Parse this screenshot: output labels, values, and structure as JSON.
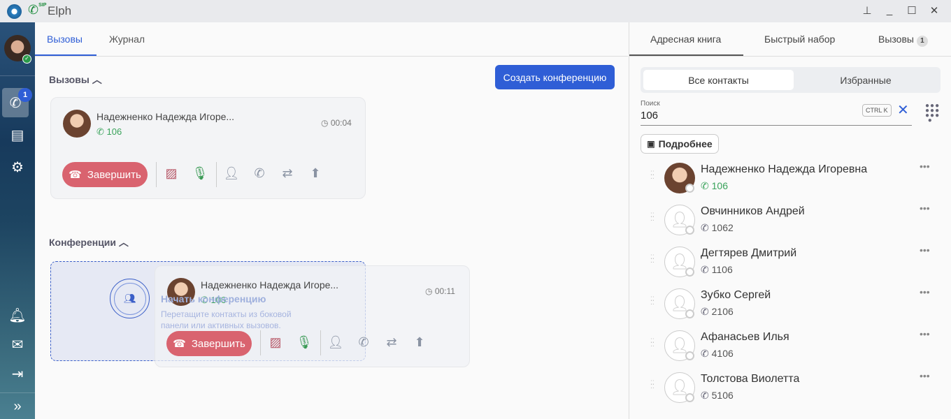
{
  "window": {
    "title": "Elph",
    "sip_label": "SIP",
    "controls": [
      "pin",
      "minimize",
      "maximize",
      "close"
    ]
  },
  "sidebar": {
    "calls_badge": "1",
    "items": [
      "phone-icon",
      "chat-icon",
      "settings-icon"
    ],
    "bottom": [
      "bell-icon",
      "mail-icon",
      "logout-icon",
      "expand-icon"
    ]
  },
  "main": {
    "tabs": [
      {
        "label": "Вызовы",
        "active": true
      },
      {
        "label": "Журнал"
      }
    ],
    "calls_section": "Вызовы",
    "create_conference": "Создать конференцию",
    "call": {
      "name": "Надежненко Надежда Игоре...",
      "number": "106",
      "duration": "00:04",
      "end_label": "Завершить"
    },
    "conferences_section": "Конференции",
    "conference_drop": {
      "title": "Начать конференцию",
      "hint_line1": "Перетащите контакты из боковой",
      "hint_line2": "панели или активных вызовов."
    },
    "dragged_call": {
      "name": "Надежненко Надежда Игоре...",
      "number": "106",
      "duration": "00:11",
      "end_label": "Завершить"
    }
  },
  "right": {
    "tabs": [
      {
        "label": "Адресная книга",
        "active": true
      },
      {
        "label": "Быстрый набор"
      },
      {
        "label": "Вызовы",
        "badge": "1"
      }
    ],
    "filter": [
      "Все контакты",
      "Избранные"
    ],
    "search": {
      "label": "Поиск",
      "value": "106",
      "shortcut": "CTRL K"
    },
    "details_button": "Подробнее",
    "contacts": [
      {
        "name": "Надежненко Надежда Игоревна",
        "number": "106",
        "has_photo": true,
        "number_color": "#3aa35b"
      },
      {
        "name": "Овчинников Андрей",
        "number": "1062"
      },
      {
        "name": "Дегтярев Дмитрий",
        "number": "1106"
      },
      {
        "name": "Зубко Сергей",
        "number": "2106"
      },
      {
        "name": "Афанасьев Илья",
        "number": "4106"
      },
      {
        "name": "Толстова Виолетта",
        "number": "5106"
      }
    ]
  },
  "colors": {
    "accent": "#2f5ed6",
    "end_call": "#d9636f",
    "green": "#3aa35b"
  }
}
